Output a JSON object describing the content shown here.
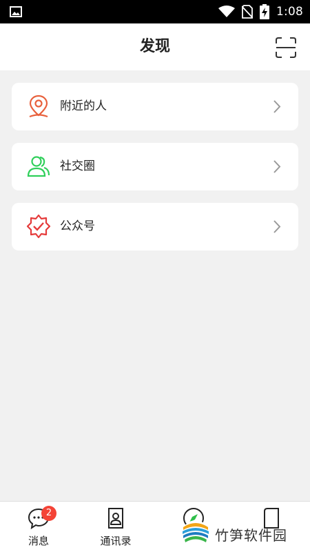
{
  "status_bar": {
    "time": "1:08",
    "icons": [
      "image-icon",
      "wifi-icon",
      "no-sim-icon",
      "battery-charging-icon"
    ]
  },
  "header": {
    "title": "发现",
    "scan_icon": "scan-icon"
  },
  "menu": [
    {
      "label": "附近的人",
      "icon": "location-pin-icon",
      "color": "#e8603c"
    },
    {
      "label": "社交圈",
      "icon": "people-icon",
      "color": "#2fcf5a"
    },
    {
      "label": "公众号",
      "icon": "verified-badge-icon",
      "color": "#e53a3a"
    }
  ],
  "tabbar": {
    "tabs": [
      {
        "label": "消息",
        "icon": "chat-bubble-icon",
        "badge": "2"
      },
      {
        "label": "通讯录",
        "icon": "contacts-icon"
      },
      {
        "label": "",
        "icon": "discover-icon"
      },
      {
        "label": "",
        "icon": "profile-icon"
      }
    ]
  },
  "watermark": {
    "text": "竹笋软件园"
  },
  "colors": {
    "background": "#f1f1f1",
    "badge": "#f44336"
  }
}
